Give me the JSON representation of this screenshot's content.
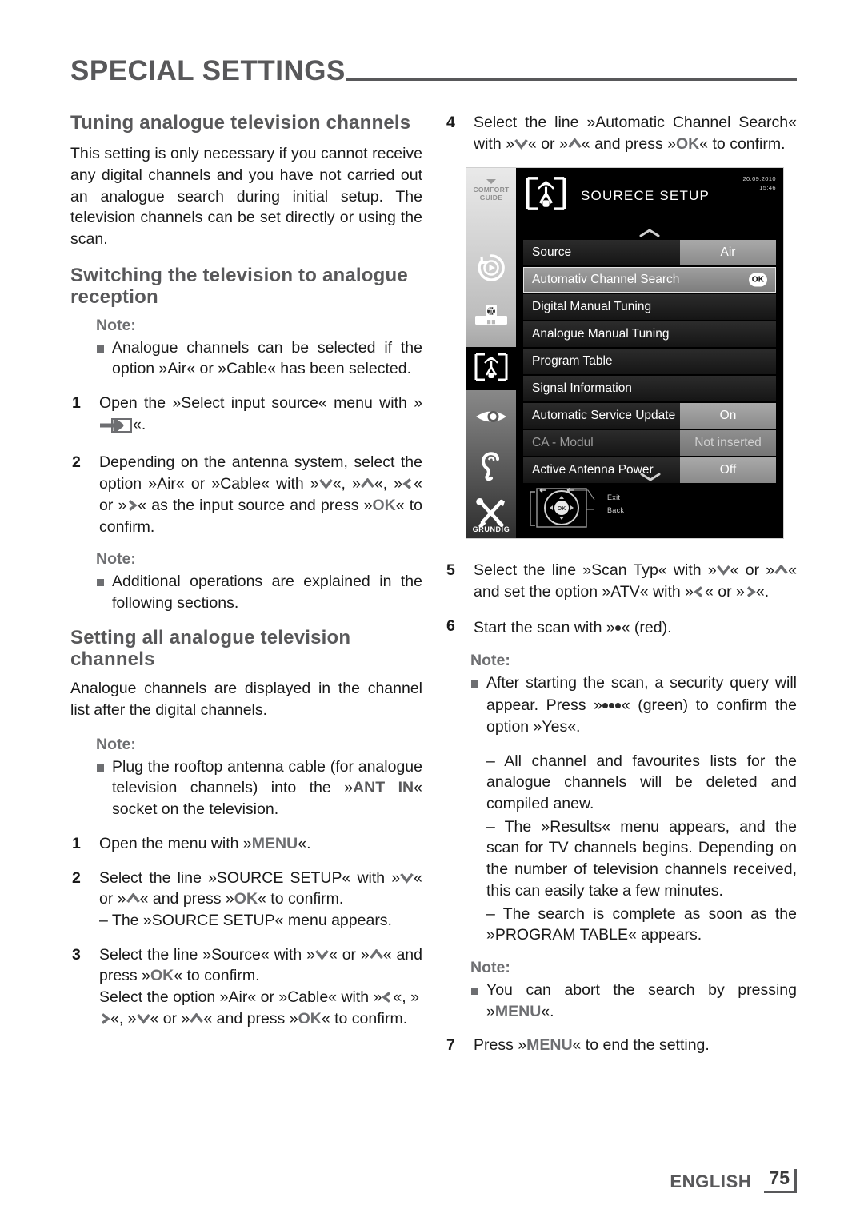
{
  "header": {
    "title": "SPECIAL SETTINGS"
  },
  "left_column": {
    "heading_1": "Tuning analogue television channels",
    "para_1": "This setting is only necessary if you cannot receive any digital channels and you have not carried out an analogue search during initial setup. The television channels can be set directly or using the scan.",
    "heading_2": "Switching the television to analogue reception",
    "note_label_1": "Note:",
    "note_1": "Analogue channels can be selected if the option »Air« or »Cable« has been selected.",
    "step_1_num": "1",
    "step_1_a": "Open the »Select input source« menu with »",
    "step_1_b": "«.",
    "step_2_num": "2",
    "step_2_a": "Depending on the antenna system, select the option »Air« or »Cable« with »",
    "step_2_b": "«, »",
    "step_2_c": "«, »",
    "step_2_d": "« or »",
    "step_2_e": "« as the input source and press »",
    "step_2_ok": "OK",
    "step_2_f": "« to confirm.",
    "note_label_2": "Note:",
    "note_2": "Additional operations are explained in the following sections.",
    "heading_3": "Setting all analogue television channels",
    "para_2": "Analogue channels are displayed in the channel list after the digital channels.",
    "note_label_3": "Note:",
    "note_3_a": "Plug the rooftop antenna cable (for analogue television channels) into the »",
    "note_3_key": "ANT IN",
    "note_3_b": "« socket on the television.",
    "step_3_num": "1",
    "step_3_a": "Open the menu with »",
    "step_3_key": "MENU",
    "step_3_b": "«.",
    "step_4_num": "2",
    "step_4_a": "Select the line »SOURCE SETUP« with »",
    "step_4_b": "« or »",
    "step_4_c": "« and press »",
    "step_4_ok": "OK",
    "step_4_d": "« to confirm.",
    "step_4_sub": "– The »SOURCE SETUP« menu appears.",
    "step_5_num": "3",
    "step_5_a": "Select the line »Source« with »",
    "step_5_b": "« or »",
    "step_5_c": "« and press »",
    "step_5_ok": "OK",
    "step_5_d": "« to confirm.",
    "step_5_e": "Select the option »Air« or »Cable« with »",
    "step_5_f": "«, »",
    "step_5_g": "«, »",
    "step_5_h": "« or »",
    "step_5_i": "« and press »",
    "step_5_ok2": "OK",
    "step_5_j": "« to confirm."
  },
  "right_column": {
    "step_4_num": "4",
    "step_4_a": "Select the line »Automatic Channel Search« with »",
    "step_4_b": "« or »",
    "step_4_c": "« and press »",
    "step_4_ok": "OK",
    "step_4_d": "« to confirm.",
    "step_5_num": "5",
    "step_5_a": "Select the line »Scan Typ« with »",
    "step_5_b": "« or »",
    "step_5_c": "« and set the option »ATV« with »",
    "step_5_d": "« or »",
    "step_5_e": "«.",
    "step_6_num": "6",
    "step_6_a": "Start the scan with »",
    "step_6_b": "« (red).",
    "note_label_1": "Note:",
    "note_1_a": "After starting the scan, a security query will appear. Press »",
    "note_1_b": "« (green) to confirm the option »Yes«.",
    "dash_1": "– All channel and favourites lists for the analogue channels will be deleted and compiled anew.",
    "dash_2": "– The »Results« menu appears, and the scan for TV channels begins. Depending on the number of television channels received, this can easily take a few minutes.",
    "dash_3": "– The search is complete as soon as the »PROGRAM TABLE« appears.",
    "note_label_2": "Note:",
    "note_2_a": "You can abort the search by pressing »",
    "note_2_key": "MENU",
    "note_2_b": "«.",
    "step_7_num": "7",
    "step_7_a": "Press »",
    "step_7_key": "MENU",
    "step_7_b": "« to end the setting."
  },
  "tv_screenshot": {
    "sidebar": {
      "comfort_label_line1": "COMFORT",
      "comfort_label_line2": "GUIDE",
      "brand": "GRUNDIG",
      "icons": [
        "playback-circle-icon",
        "input-source-icon",
        "source-setup-antenna-icon",
        "eye-picture-icon",
        "ear-sound-icon",
        "tools-settings-icon"
      ]
    },
    "title": "SOURECE SETUP",
    "date": "20.09.2010",
    "time": "15:46",
    "rows": [
      {
        "label": "Source",
        "value": "Air",
        "state": "normal"
      },
      {
        "label": "Automativ Channel Search",
        "value": "OK",
        "state": "selected"
      },
      {
        "label": "Digital Manual Tuning",
        "value": "",
        "state": "normal"
      },
      {
        "label": "Analogue Manual Tuning",
        "value": "",
        "state": "normal"
      },
      {
        "label": "Program Table",
        "value": "",
        "state": "normal"
      },
      {
        "label": "Signal Information",
        "value": "",
        "state": "normal"
      },
      {
        "label": "Automatic Service Update",
        "value": "On",
        "state": "normal"
      },
      {
        "label": "CA - Modul",
        "value": "Not inserted",
        "state": "dim"
      },
      {
        "label": "Active Antenna Power",
        "value": "Off",
        "state": "normal"
      }
    ],
    "footer_keys": {
      "exit": "Exit",
      "back": "Back",
      "ok": "OK"
    }
  },
  "footer": {
    "language": "ENGLISH",
    "page": "75"
  },
  "colors": {
    "heading_gray": "#58585a",
    "key_gray": "#6d6e71",
    "text_black": "#1a1a1a"
  }
}
